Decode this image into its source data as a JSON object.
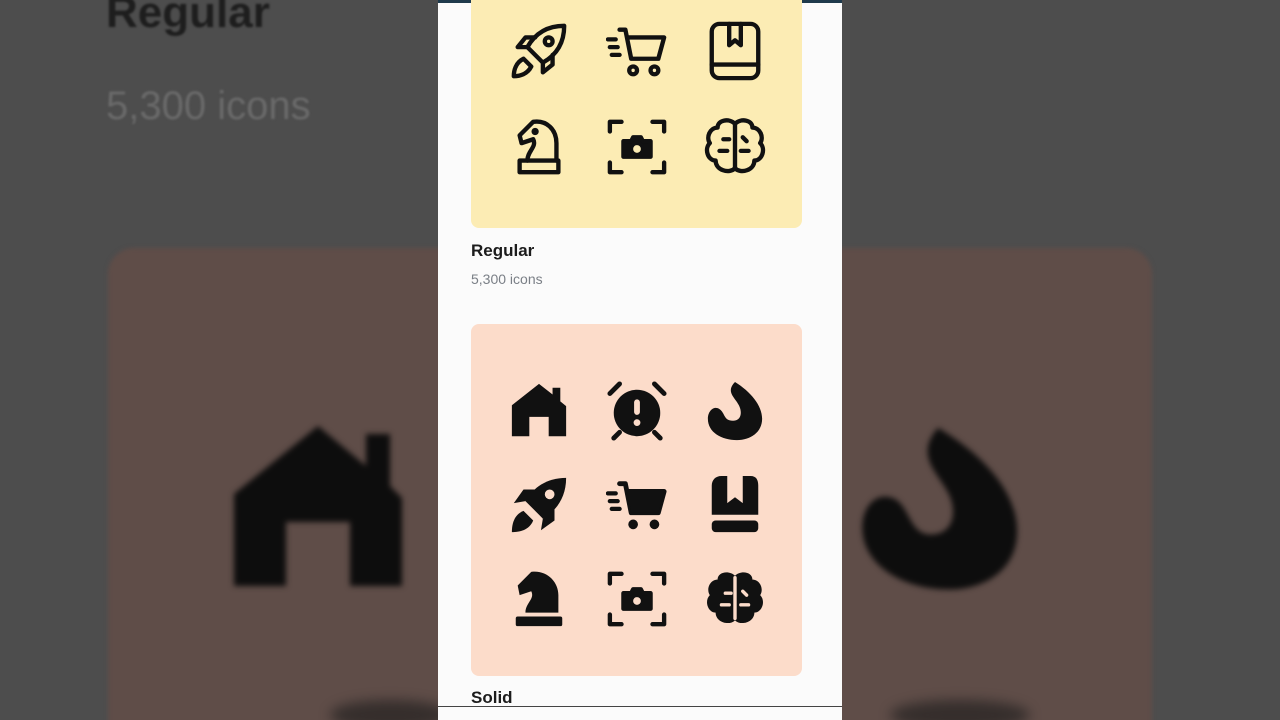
{
  "background": {
    "title": "Regular",
    "count": "5,300 icons"
  },
  "sections": [
    {
      "name": "Regular",
      "count": "5,300 icons",
      "color": "#fcecb4",
      "icons": [
        "rocket-icon",
        "fast-cart-icon",
        "book-bookmark-icon",
        "chess-knight-icon",
        "camera-focus-icon",
        "brain-icon"
      ]
    },
    {
      "name": "Solid",
      "color": "#fcdcca",
      "icons": [
        "home-icon",
        "alarm-exclamation-icon",
        "flame-icon",
        "rocket-icon",
        "fast-cart-icon",
        "book-bookmark-icon",
        "chess-knight-icon",
        "camera-focus-icon",
        "brain-icon"
      ]
    }
  ]
}
